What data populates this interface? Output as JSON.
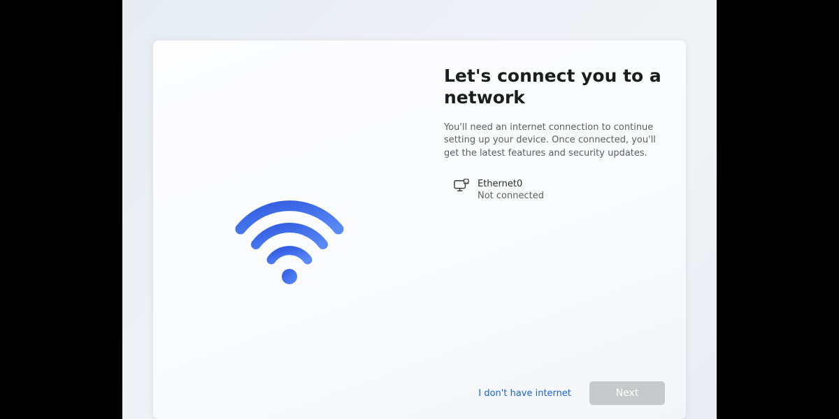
{
  "heading": "Let's connect you to a network",
  "subtitle": "You'll need an internet connection to continue setting up your device. Once connected, you'll get the latest features and security updates.",
  "network": {
    "name": "Ethernet0",
    "status": "Not connected"
  },
  "actions": {
    "no_internet": "I don't have internet",
    "next": "Next"
  },
  "colors": {
    "accent_start": "#2f5be0",
    "accent_end": "#4a7bf2"
  }
}
